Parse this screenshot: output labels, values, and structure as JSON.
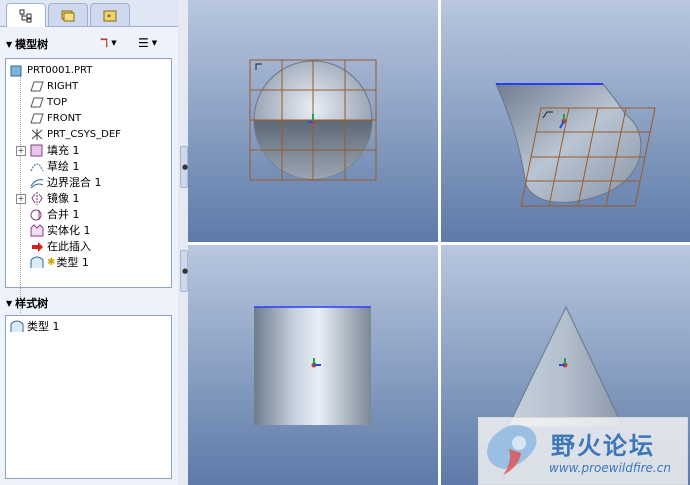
{
  "model_tree": {
    "title": "模型树",
    "items": [
      {
        "label": "PRT0001.PRT",
        "icon": "part-icon"
      },
      {
        "label": "RIGHT",
        "icon": "datum-plane-icon"
      },
      {
        "label": "TOP",
        "icon": "datum-plane-icon"
      },
      {
        "label": "FRONT",
        "icon": "datum-plane-icon"
      },
      {
        "label": "PRT_CSYS_DEF",
        "icon": "csys-icon"
      },
      {
        "label": "填充 1",
        "icon": "fill-icon"
      },
      {
        "label": "草绘 1",
        "icon": "sketch-icon"
      },
      {
        "label": "边界混合 1",
        "icon": "boundary-blend-icon"
      },
      {
        "label": "镜像 1",
        "icon": "mirror-icon"
      },
      {
        "label": "合并 1",
        "icon": "merge-icon"
      },
      {
        "label": "实体化 1",
        "icon": "solidify-icon"
      },
      {
        "label": "在此插入",
        "icon": "insert-here-arrow-icon"
      },
      {
        "label": "类型 1",
        "icon": "style-type-icon"
      }
    ]
  },
  "style_tree": {
    "title": "样式树",
    "items": [
      {
        "label": "类型 1",
        "icon": "style-type-icon"
      }
    ]
  },
  "watermark": {
    "brand": "野火论坛",
    "url": "www.proewildfire.cn"
  },
  "colors": {
    "viewport_top": "#b9c7df",
    "viewport_bottom": "#5d7aa8",
    "grid": "#9a5a2a",
    "model_edge": "#2a3cff",
    "brand": "#3d77b8"
  }
}
